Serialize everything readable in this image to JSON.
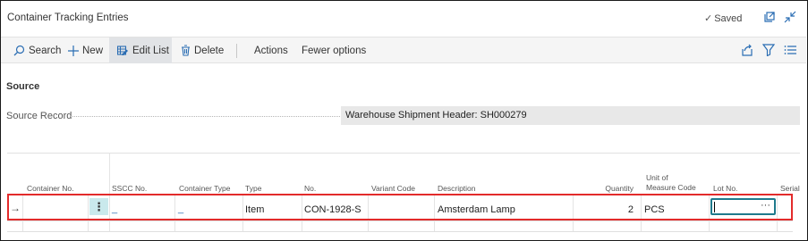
{
  "window": {
    "title": "Container Tracking Entries",
    "saved_label": "Saved"
  },
  "toolbar": {
    "search": "Search",
    "new": "New",
    "edit_list": "Edit List",
    "delete": "Delete",
    "actions": "Actions",
    "fewer_options": "Fewer options"
  },
  "source": {
    "heading": "Source",
    "record_label": "Source Record",
    "record_value": "Warehouse Shipment Header: SH000279"
  },
  "grid": {
    "columns": {
      "container_no": "Container No.",
      "sscc_no": "SSCC No.",
      "container_type": "Container Type",
      "type": "Type",
      "no": "No.",
      "variant_code": "Variant Code",
      "description": "Description",
      "quantity": "Quantity",
      "uom_line1": "Unit of",
      "uom_line2": "Measure Code",
      "lot_no": "Lot No.",
      "serial": "Serial"
    },
    "row": {
      "container_no": "",
      "sscc_no": "_",
      "container_type": "_",
      "type": "Item",
      "no": "CON-1928-S",
      "variant_code": "",
      "description": "Amsterdam Lamp",
      "quantity": "2",
      "uom": "PCS",
      "lot_no": "",
      "lot_lookup": "···"
    }
  },
  "icons": {
    "saved": "check-icon",
    "open_new": "open-in-new-icon",
    "collapse": "collapse-icon",
    "search": "search-icon",
    "new": "plus-icon",
    "edit_list": "edit-list-icon",
    "delete": "trash-icon",
    "share": "share-icon",
    "filter": "filter-icon",
    "list_view": "list-view-icon",
    "row_indicator": "arrow-right-icon",
    "row_menu": "vertical-ellipsis-icon"
  },
  "colors": {
    "accent": "#2a6db3",
    "selection_cell": "#c9e9ec",
    "focus_border": "#1f7a8c",
    "highlight_border": "#e32b2b"
  }
}
